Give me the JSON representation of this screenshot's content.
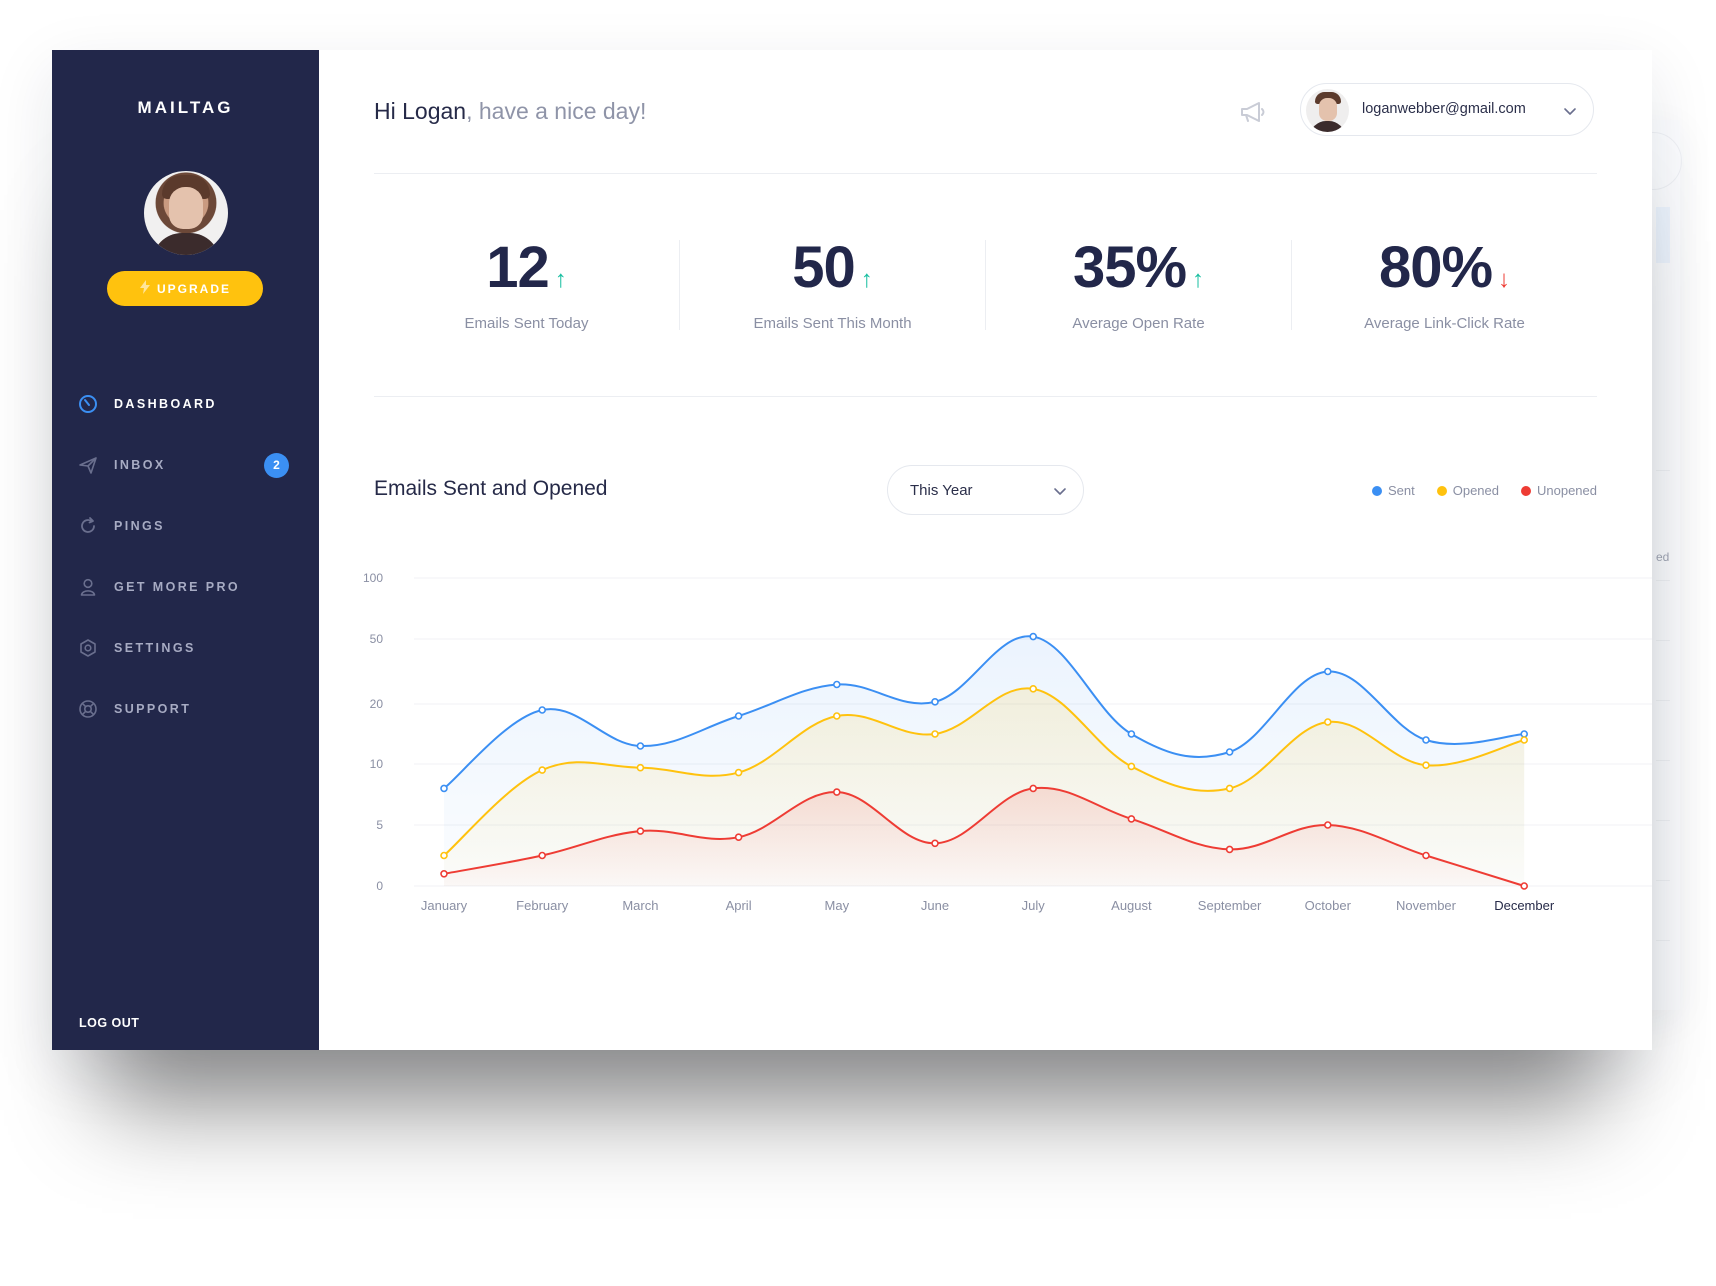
{
  "brand": "MAILTAG",
  "sidebar": {
    "upgrade_label": "UPGRADE",
    "items": [
      {
        "label": "DASHBOARD",
        "icon": "dashboard-icon",
        "active": true
      },
      {
        "label": "INBOX",
        "icon": "send-icon",
        "badge": "2"
      },
      {
        "label": "PINGS",
        "icon": "refresh-icon"
      },
      {
        "label": "GET MORE PRO",
        "icon": "user-icon"
      },
      {
        "label": "SETTINGS",
        "icon": "gear-icon"
      },
      {
        "label": "SUPPORT",
        "icon": "lifebuoy-icon"
      }
    ],
    "logout_label": "LOG OUT"
  },
  "header": {
    "greeting_name": "Hi Logan",
    "greeting_rest": ", have a nice day!",
    "user_email": "loganwebber@gmail.com"
  },
  "stats": [
    {
      "value": "12",
      "label": "Emails Sent Today",
      "trend": "up"
    },
    {
      "value": "50",
      "label": "Emails Sent This Month",
      "trend": "up"
    },
    {
      "value": "35%",
      "label": "Average Open Rate",
      "trend": "up"
    },
    {
      "value": "80%",
      "label": "Average Link-Click Rate",
      "trend": "down"
    }
  ],
  "chart_section": {
    "title": "Emails Sent and Opened",
    "period": "This Year"
  },
  "ghost": {
    "fragment": "ed"
  },
  "colors": {
    "sidebar": "#22274a",
    "accent": "#3b8ff3",
    "upgrade": "#ffc20e",
    "up": "#19bfa1",
    "down": "#ee3c34",
    "sent": "#3b8ff3",
    "opened": "#ffc20e",
    "unopened": "#ee3c34"
  },
  "chart_data": {
    "type": "line",
    "categories": [
      "January",
      "February",
      "March",
      "April",
      "May",
      "June",
      "July",
      "August",
      "September",
      "October",
      "November",
      "December"
    ],
    "yticks": [
      "0",
      "5",
      "10",
      "20",
      "50",
      "100"
    ],
    "series": [
      {
        "name": "Sent",
        "color": "#3b8ff3",
        "values": [
          8,
          19,
          13,
          18,
          29,
          21,
          52,
          15,
          12,
          35,
          14,
          15
        ]
      },
      {
        "name": "Opened",
        "color": "#ffc20e",
        "values": [
          2.5,
          9.5,
          9.7,
          9.3,
          18,
          15,
          27,
          9.8,
          8,
          17,
          9.9,
          14
        ]
      },
      {
        "name": "Unopened",
        "color": "#ee3c34",
        "values": [
          1,
          2.5,
          4.5,
          4,
          7.7,
          3.5,
          8,
          5.5,
          3,
          5,
          2.5,
          0
        ]
      }
    ],
    "grid": true,
    "legend_position": "top-right"
  }
}
